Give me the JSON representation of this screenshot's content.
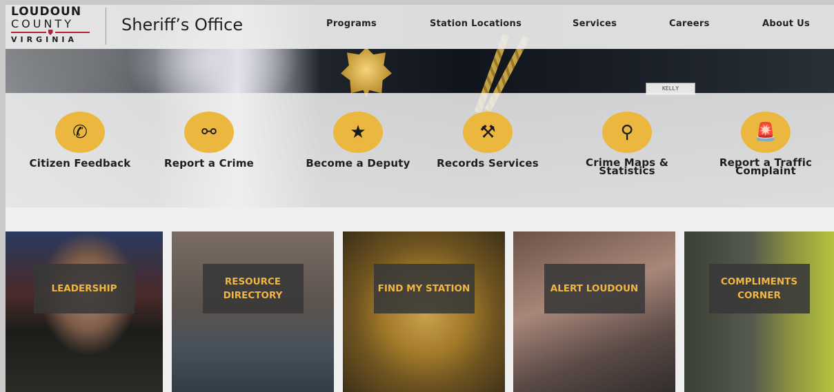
{
  "header": {
    "logo": {
      "line1": "LOUDOUN",
      "line2": "COUNTY",
      "line3": "VIRGINIA"
    },
    "site_title": "Sheriff’s Office",
    "nav": [
      {
        "label": "Programs"
      },
      {
        "label": "Station Locations"
      },
      {
        "label": "Services"
      },
      {
        "label": "Careers"
      },
      {
        "label": "About Us"
      }
    ]
  },
  "hero": {
    "nameplate_text": "KELLY"
  },
  "quick_links": [
    {
      "label": "Citizen Feedback",
      "icon": "phone-icon"
    },
    {
      "label": "Report a Crime",
      "icon": "handcuffs-icon"
    },
    {
      "label": "Become a Deputy",
      "icon": "star-icon"
    },
    {
      "label": "Records Services",
      "icon": "gavel-icon"
    },
    {
      "label": "Crime Maps & Statistics",
      "icon": "map-pin-icon"
    },
    {
      "label": "Report a Traffic Complaint",
      "icon": "siren-icon"
    }
  ],
  "cards": [
    {
      "label": "LEADERSHIP"
    },
    {
      "label": "RESOURCE DIRECTORY"
    },
    {
      "label": "FIND MY STATION"
    },
    {
      "label": "ALERT LOUDOUN"
    },
    {
      "label": "COMPLIMENTS CORNER"
    }
  ],
  "colors": {
    "accent": "#ebb73f",
    "card_label": "#f1b643",
    "card_box": "#383838",
    "logo_red": "#b22234"
  }
}
